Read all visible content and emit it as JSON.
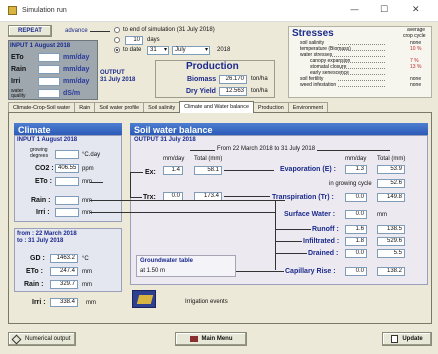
{
  "window": {
    "title": "Simulation run",
    "min": "—",
    "max": "☐",
    "close": "✕"
  },
  "top": {
    "repeat_label": "REPEAT",
    "advance_label": "advance",
    "opt_end": "to end of simulation  (31 July 2018)",
    "opt_days_value": "10",
    "opt_days_label": "days",
    "opt_date_label": "to date",
    "date_day": "31",
    "date_month": "July",
    "date_year": "2018"
  },
  "input_panel": {
    "title": "INPUT  1 August 2018",
    "rows": [
      {
        "label": "ETo",
        "unit": "mm/day"
      },
      {
        "label": "Rain",
        "unit": "mm/day"
      },
      {
        "label": "Irri",
        "unit": "mm/day"
      },
      {
        "label": "water quality",
        "unit": "dS/m"
      }
    ]
  },
  "output_box": {
    "line1": "OUTPUT",
    "line2": "31 July 2018"
  },
  "production": {
    "title": "Production",
    "biomass_label": "Biomass",
    "biomass_value": "26.170",
    "biomass_unit": "ton/ha",
    "dry_label": "Dry Yield",
    "dry_value": "12.563",
    "dry_unit": "ton/ha"
  },
  "stresses": {
    "title": "Stresses",
    "col_head1": "average",
    "col_head2": "crop cycle",
    "rows": [
      {
        "label": "soil salinity",
        "value": "none"
      },
      {
        "label": "temperature (Biomass)",
        "value": "10 %"
      },
      {
        "label": "water stresses",
        "value": ""
      },
      {
        "label": "canopy expansion",
        "value": "7 %"
      },
      {
        "label": "stomatal closure",
        "value": "13 %"
      },
      {
        "label": "early senescence",
        "value": ""
      },
      {
        "label": "soil fertility",
        "value": "none"
      },
      {
        "label": "weed infestation",
        "value": "none"
      }
    ]
  },
  "tabs": [
    {
      "label": "Climate-Crop-Soil water"
    },
    {
      "label": "Rain"
    },
    {
      "label": "Soil water profile"
    },
    {
      "label": "Soil salinity"
    },
    {
      "label": "Climate and Water balance"
    },
    {
      "label": "Production"
    },
    {
      "label": "Environment"
    }
  ],
  "climate": {
    "title": "Climate",
    "input_date": "INPUT  1 August 2018",
    "gdd_label": "growing degrees",
    "gdd_unit": "°C.day",
    "co2_label": "CO2 :",
    "co2_value": "406.55",
    "co2_unit": "ppm",
    "eto_label": "ETo :",
    "eto_unit": "mm",
    "rain_label": "Rain :",
    "rain_unit": "mm",
    "irri_label": "Irri :",
    "irri_unit": "mm",
    "period_from": "from : 22 March 2018",
    "period_to": "to : 31 July 2018",
    "gd_label": "GD :",
    "gd_value": "1463.2",
    "gd_unit": "°C",
    "eto2_label": "ETo :",
    "eto2_value": "247.4",
    "eto2_unit": "mm",
    "rain2_label": "Rain :",
    "rain2_value": "329.7",
    "rain2_unit": "mm",
    "irri2_label": "Irri :",
    "irri2_value": "338.4",
    "irri2_unit": "mm",
    "irrig_events": "Irrigation events"
  },
  "swb": {
    "title": "Soil water balance",
    "output_date": "OUTPUT  31 July 2018",
    "range": "From 22 March 2018 to 31 July 2018",
    "mmday": "mm/day",
    "total_mm": "Total (mm)",
    "ex_label": "Ex:",
    "ex_day": "1.4",
    "ex_total": "58.1",
    "trx_label": "Trx:",
    "trx_day": "0.0",
    "trx_total": "173.4",
    "evap_label": "Evaporation (E) :",
    "evap_day": "1.3",
    "evap_total": "53.9",
    "in_gc": "in growing cycle",
    "in_gc_value": "52.6",
    "transp_label": "Transpiration (Tr) :",
    "transp_day": "0.0",
    "transp_total": "149.8",
    "surface_label": "Surface Water :",
    "surface_value": "0.0",
    "surface_unit": "mm",
    "runoff_label": "Runoff :",
    "runoff_day": "1.6",
    "runoff_total": "138.5",
    "infil_label": "Infiltrated :",
    "infil_day": "1.8",
    "infil_total": "529.6",
    "drained_label": "Drained :",
    "drained_day": "0.0",
    "drained_total": "5.5",
    "gw_title": "Groundwater table",
    "gw_depth": "at 1.50 m",
    "cap_label": "Capillary Rise :",
    "cap_day": "0.0",
    "cap_total": "138.2"
  },
  "footer": {
    "numerical": "Numerical output",
    "main_menu": "Main Menu",
    "update": "Update"
  }
}
